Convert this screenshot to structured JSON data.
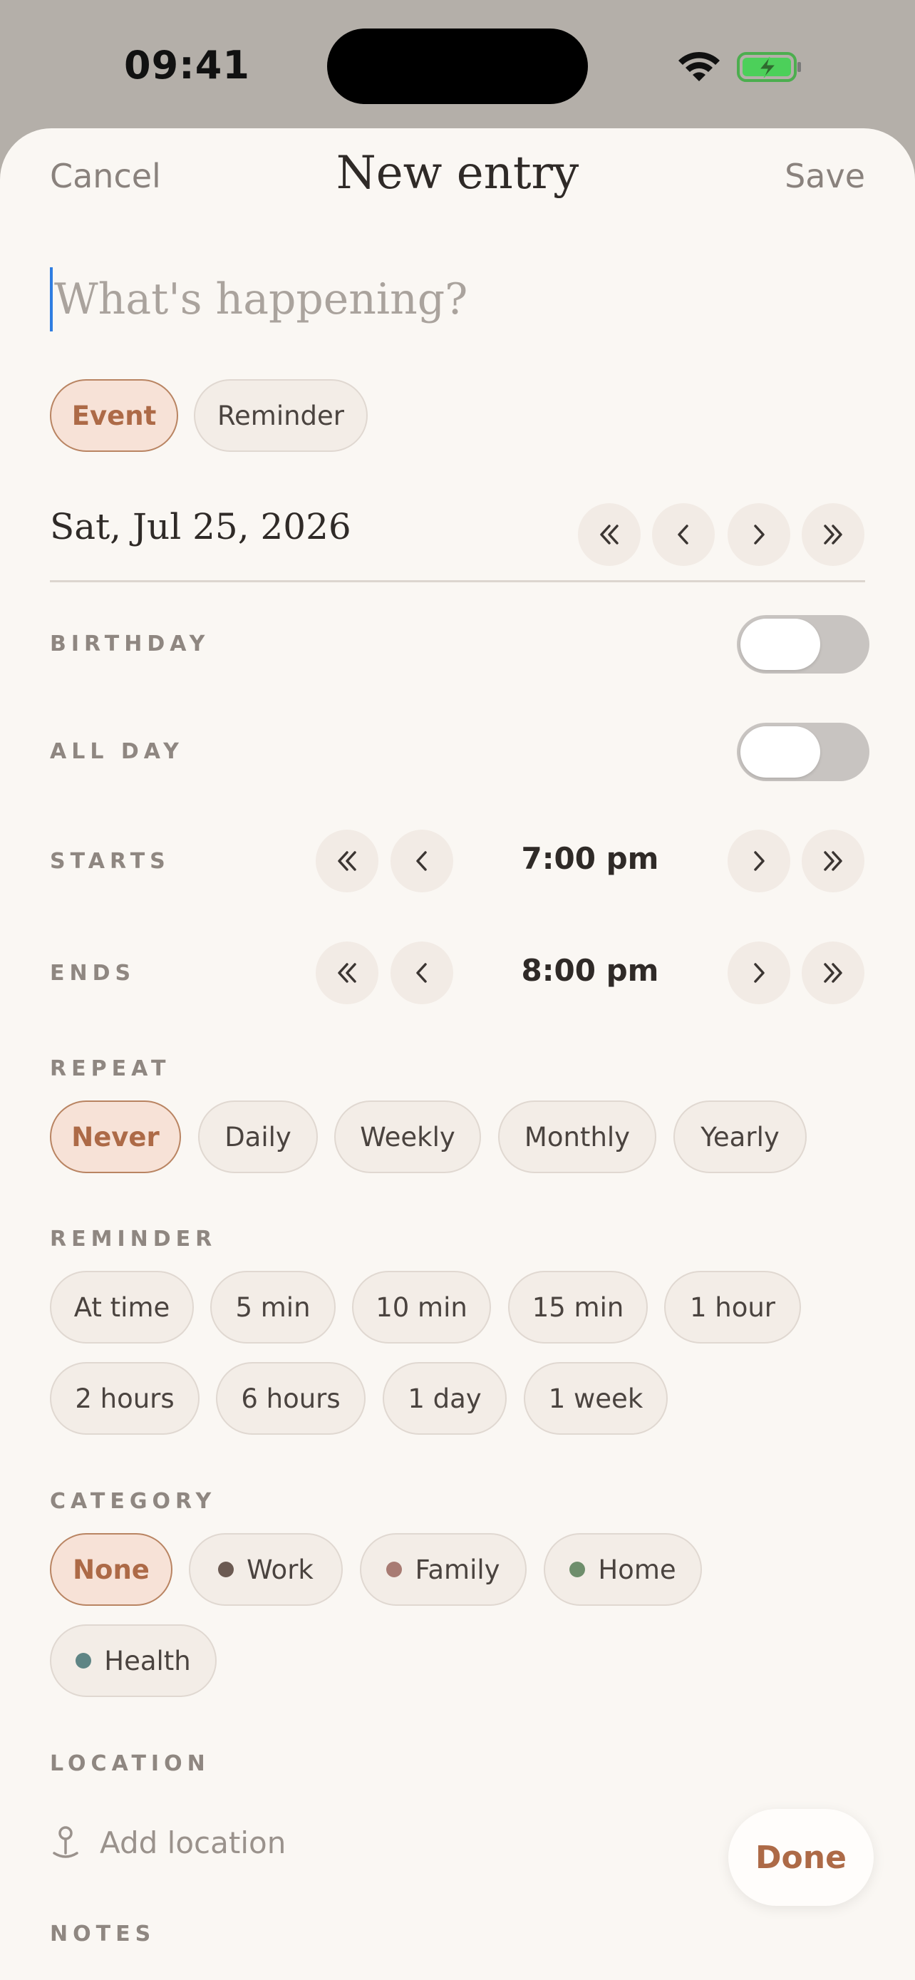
{
  "status": {
    "time": "09:41"
  },
  "nav": {
    "cancel": "Cancel",
    "title": "New entry",
    "save": "Save"
  },
  "entry": {
    "title_value": "",
    "title_placeholder": "What's happening?"
  },
  "type_options": [
    {
      "label": "Event",
      "selected": true
    },
    {
      "label": "Reminder",
      "selected": false
    }
  ],
  "date": {
    "value": "Sat, Jul 25, 2026"
  },
  "birthday": {
    "label": "BIRTHDAY",
    "on": false
  },
  "all_day": {
    "label": "ALL DAY",
    "on": false
  },
  "starts": {
    "label": "STARTS",
    "value": "7:00 pm"
  },
  "ends": {
    "label": "ENDS",
    "value": "8:00 pm"
  },
  "repeat": {
    "label": "REPEAT",
    "options": [
      "Never",
      "Daily",
      "Weekly",
      "Monthly",
      "Yearly"
    ],
    "selected": "Never"
  },
  "reminder": {
    "label": "REMINDER",
    "options": [
      "At time",
      "5 min",
      "10 min",
      "15 min",
      "1 hour",
      "2 hours",
      "6 hours",
      "1 day",
      "1 week"
    ]
  },
  "category": {
    "label": "CATEGORY",
    "options": [
      {
        "label": "None",
        "selected": true,
        "color": null
      },
      {
        "label": "Work",
        "selected": false,
        "color": "#6b5a52"
      },
      {
        "label": "Family",
        "selected": false,
        "color": "#a87b73"
      },
      {
        "label": "Home",
        "selected": false,
        "color": "#6e8e6c"
      },
      {
        "label": "Health",
        "selected": false,
        "color": "#5f8585"
      }
    ]
  },
  "location": {
    "label": "LOCATION",
    "placeholder": "Add location"
  },
  "notes": {
    "label": "NOTES"
  },
  "done": "Done",
  "colors": {
    "accent": "#ad6a47",
    "chip_bg": "#f3ede7",
    "active_bg": "#f7e2d7",
    "sheet_bg": "#faf7f3"
  }
}
